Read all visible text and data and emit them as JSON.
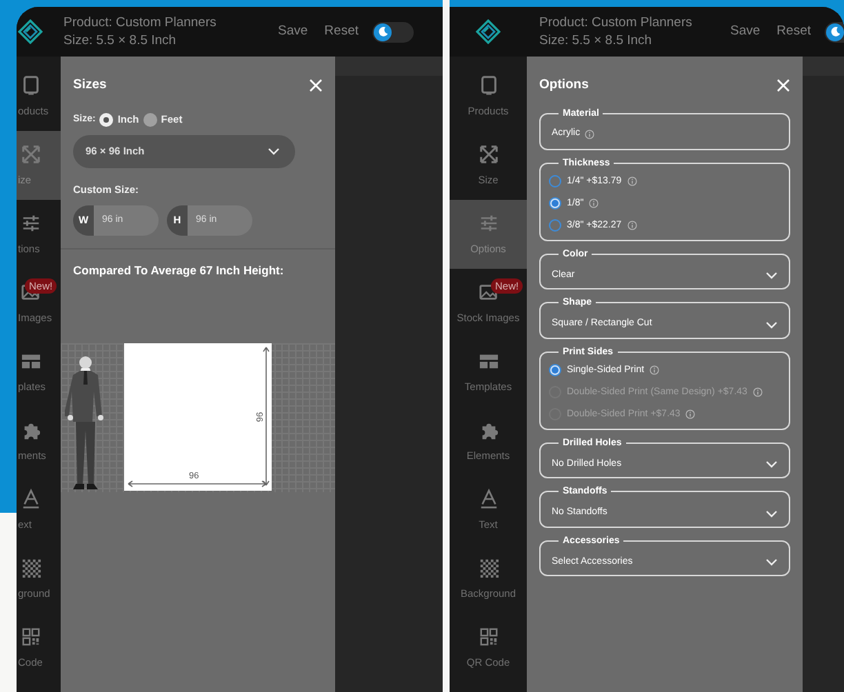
{
  "screens": [
    {
      "header": {
        "product": "Product: Custom Planners",
        "size": "Size: 5.5 × 8.5 Inch",
        "buttons": [
          "Save",
          "Reset"
        ],
        "theme_toggle_on": false
      },
      "sidebar": [
        {
          "label": "oducts",
          "selected": false
        },
        {
          "label": "ize",
          "selected": true
        },
        {
          "label": "tions",
          "selected": false
        },
        {
          "label": "Images",
          "selected": false,
          "badge": "New!"
        },
        {
          "label": "plates",
          "selected": false
        },
        {
          "label": "ments",
          "selected": false
        },
        {
          "label": "ext",
          "selected": false
        },
        {
          "label": "ground",
          "selected": false
        },
        {
          "label": "Code",
          "selected": false
        }
      ],
      "dialog": {
        "kind": "sizes",
        "title": "Sizes",
        "unit_label": "Size:",
        "units": [
          {
            "label": "Inch",
            "selected": true
          },
          {
            "label": "Feet",
            "selected": false
          }
        ],
        "preset": "96 × 96 Inch",
        "custom_label": "Custom Size:",
        "fields": [
          {
            "prefix": "W",
            "value": "96 in"
          },
          {
            "prefix": "H",
            "value": "96 in"
          }
        ],
        "compare_heading": "Compared To Average 67 Inch Height:",
        "preview": {
          "width_label": "96",
          "height_label": "96"
        }
      }
    },
    {
      "header": {
        "product": "Product: Custom Planners",
        "size": "Size: 5.5 × 8.5 Inch",
        "buttons": [
          "Save",
          "Reset"
        ],
        "theme_toggle_on": false
      },
      "sidebar": [
        {
          "label": "Products",
          "selected": false
        },
        {
          "label": "Size",
          "selected": false
        },
        {
          "label": "Options",
          "selected": true
        },
        {
          "label": "Stock Images",
          "selected": false,
          "badge": "New!"
        },
        {
          "label": "Templates",
          "selected": false
        },
        {
          "label": "Elements",
          "selected": false
        },
        {
          "label": "Text",
          "selected": false
        },
        {
          "label": "Background",
          "selected": false
        },
        {
          "label": "QR Code",
          "selected": false
        }
      ],
      "dialog": {
        "kind": "options",
        "title": "Options",
        "groups": [
          {
            "kind": "static",
            "legend": "Material",
            "value": "Acrylic"
          },
          {
            "kind": "radio",
            "legend": "Thickness",
            "options": [
              {
                "label": "1/4\" +$13.79",
                "selected": false,
                "disabled": false
              },
              {
                "label": "1/8\"",
                "selected": true,
                "disabled": false
              },
              {
                "label": "3/8\" +$22.27",
                "selected": false,
                "disabled": false
              }
            ]
          },
          {
            "kind": "select",
            "legend": "Color",
            "value": "Clear"
          },
          {
            "kind": "select",
            "legend": "Shape",
            "value": "Square / Rectangle Cut"
          },
          {
            "kind": "radio",
            "legend": "Print Sides",
            "options": [
              {
                "label": "Single-Sided Print",
                "selected": true,
                "disabled": false
              },
              {
                "label": "Double-Sided Print (Same Design) +$7.43",
                "selected": false,
                "disabled": true
              },
              {
                "label": "Double-Sided Print +$7.43",
                "selected": false,
                "disabled": true
              }
            ]
          },
          {
            "kind": "select",
            "legend": "Drilled Holes",
            "value": "No Drilled Holes"
          },
          {
            "kind": "select",
            "legend": "Standoffs",
            "value": "No Standoffs"
          },
          {
            "kind": "select",
            "legend": "Accessories",
            "value": "Select Accessories"
          }
        ]
      }
    }
  ]
}
